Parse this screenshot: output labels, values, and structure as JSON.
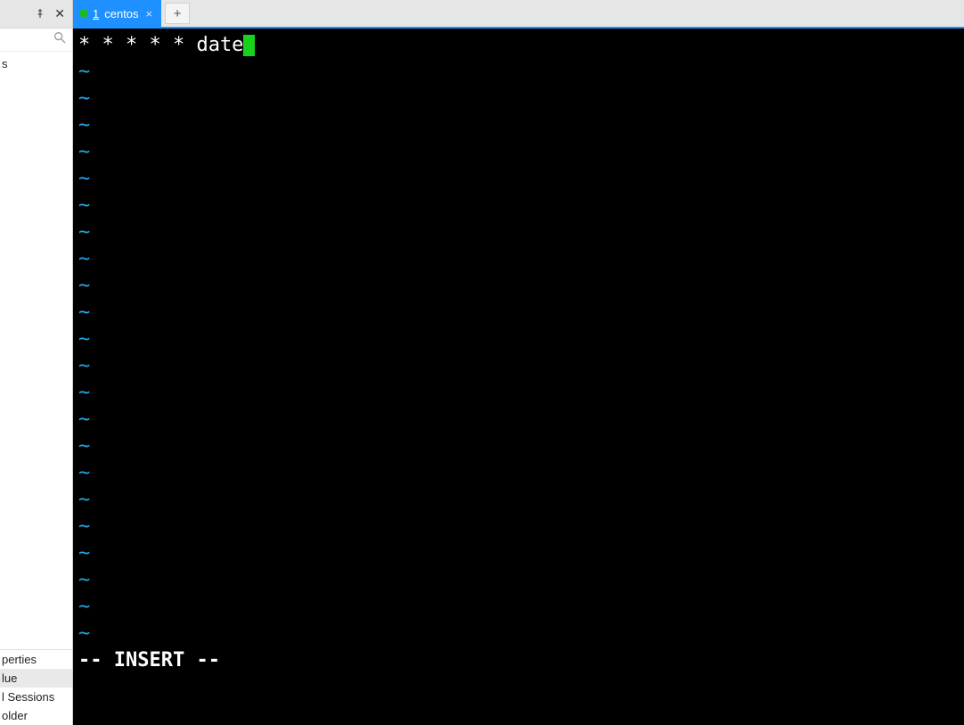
{
  "sidebar": {
    "pin_glyph": "📌",
    "close_glyph": "✕",
    "search_icon": "search-icon",
    "tree_items": [
      "s"
    ],
    "properties": [
      {
        "label": "perties",
        "selected": false
      },
      {
        "label": "lue",
        "selected": true
      },
      {
        "label": "l Sessions",
        "selected": false
      },
      {
        "label": "older",
        "selected": false
      }
    ]
  },
  "tabs": {
    "active": {
      "status": "connected",
      "number": "1",
      "title": "centos",
      "close_glyph": "×"
    },
    "new_tab_glyph": "+"
  },
  "terminal": {
    "content_line": "* * * * * date",
    "tilde_rows": 22,
    "status_line": "-- INSERT --"
  }
}
